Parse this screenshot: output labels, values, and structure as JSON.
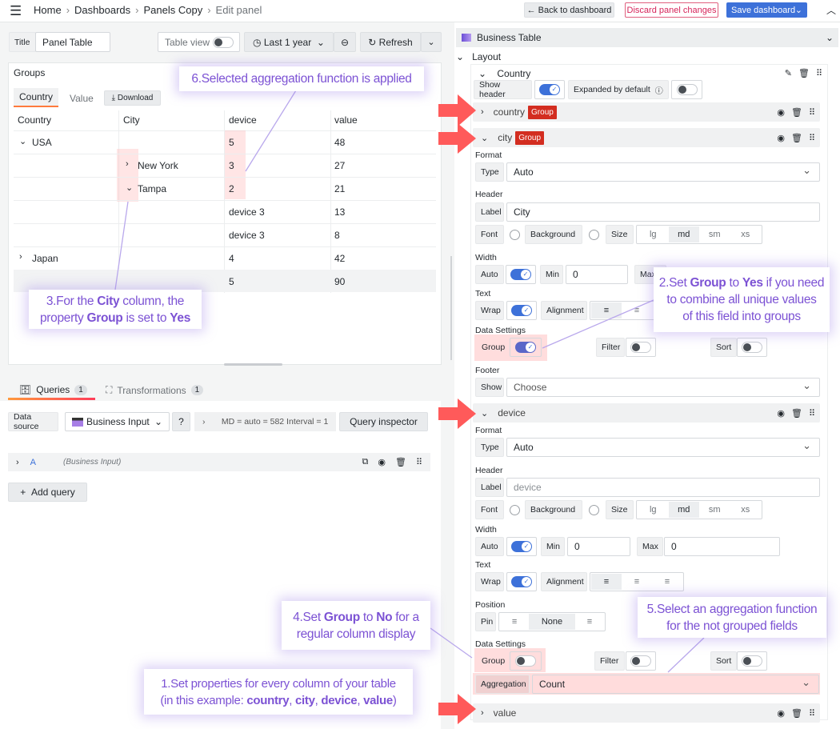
{
  "breadcrumb": [
    "Home",
    "Dashboards",
    "Panels Copy",
    "Edit panel"
  ],
  "header": {
    "back": "Back to dashboard",
    "discard": "Discard panel changes",
    "save": "Save dashboard"
  },
  "toolbar": {
    "title_label": "Title",
    "title_value": "Panel Table",
    "table_view": "Table view",
    "time_range": "Last 1 year",
    "refresh": "Refresh"
  },
  "panel": {
    "title": "Groups",
    "tabs": [
      "Country",
      "Value"
    ],
    "download": "Download",
    "columns": [
      "Country",
      "City",
      "device",
      "value"
    ],
    "rows": [
      [
        "USA",
        "",
        "5",
        "48"
      ],
      [
        "",
        "New York",
        "3",
        "27"
      ],
      [
        "",
        "Tampa",
        "2",
        "21"
      ],
      [
        "",
        "",
        "device 3",
        "13"
      ],
      [
        "",
        "",
        "device 3",
        "8"
      ],
      [
        "Japan",
        "",
        "4",
        "42"
      ]
    ],
    "footer": [
      "",
      "",
      "5",
      "90"
    ]
  },
  "query_tabs": {
    "queries": "Queries",
    "queries_count": "1",
    "transformations": "Transformations",
    "transformations_count": "1"
  },
  "query": {
    "datasource_label": "Data source",
    "datasource": "Business Input",
    "info": "MD = auto = 582   Interval = 1",
    "inspector": "Query inspector",
    "ref": "A",
    "ref_source": "(Business Input)",
    "add": "Add query"
  },
  "options": {
    "plugin": "Business Table",
    "layout": "Layout",
    "group_name": "Country",
    "show_header": "Show header",
    "expanded": "Expanded by default",
    "group_badge": "Group",
    "columns": {
      "country": "country",
      "city": "city",
      "device": "device",
      "value": "value"
    },
    "labels": {
      "format": "Format",
      "type": "Type",
      "header": "Header",
      "label": "Label",
      "font": "Font",
      "background": "Background",
      "size": "Size",
      "width": "Width",
      "auto": "Auto",
      "min": "Min",
      "max": "Max",
      "text": "Text",
      "wrap": "Wrap",
      "alignment": "Alignment",
      "data_settings": "Data Settings",
      "group": "Group",
      "filter": "Filter",
      "sort": "Sort",
      "footer": "Footer",
      "show": "Show",
      "position": "Position",
      "pin": "Pin",
      "aggregation": "Aggregation"
    },
    "sizes": [
      "lg",
      "md",
      "sm",
      "xs"
    ],
    "city": {
      "type": "Auto",
      "label": "City",
      "min": "0",
      "footer_show": "Choose",
      "group": true,
      "wrap": true,
      "auto": true
    },
    "device": {
      "type": "Auto",
      "label_placeholder": "device",
      "min": "0",
      "max": "0",
      "pin": "None",
      "aggregation": "Count",
      "group": false,
      "wrap": true,
      "auto": true
    }
  },
  "callouts": {
    "c6": "6.Selected aggregation function is applied",
    "c3a": "3.For the ",
    "c3b": "City",
    "c3c": " column, the",
    "c3d": "property ",
    "c3e": "Group",
    "c3f": " is set to ",
    "c3g": "Yes",
    "c2a": "2.Set ",
    "c2b": "Group",
    "c2c": " to ",
    "c2d": "Yes",
    "c2e": " if you need",
    "c2f": "to combine all unique values",
    "c2g": "of this field into groups",
    "c4a": "4.Set ",
    "c4b": "Group",
    "c4c": " to ",
    "c4d": "No",
    "c4e": " for a",
    "c4f": "regular column display",
    "c5a": "5.Select an aggregation function",
    "c5b": "for the not grouped fields",
    "c1a": "1.Set properties for every column of your table",
    "c1b": "(in this example: ",
    "c1c": "country",
    "c1d": ", ",
    "c1e": "city",
    "c1f": ", ",
    "c1g": "device",
    "c1h": ", ",
    "c1i": "value",
    "c1j": ")"
  },
  "colors": {
    "accent": "#3d71d9",
    "group_badge": "#d32d20",
    "arrow": "#ff5a5a",
    "callout_text": "#7c52d4",
    "tab_underline": "#ff7a3d"
  }
}
